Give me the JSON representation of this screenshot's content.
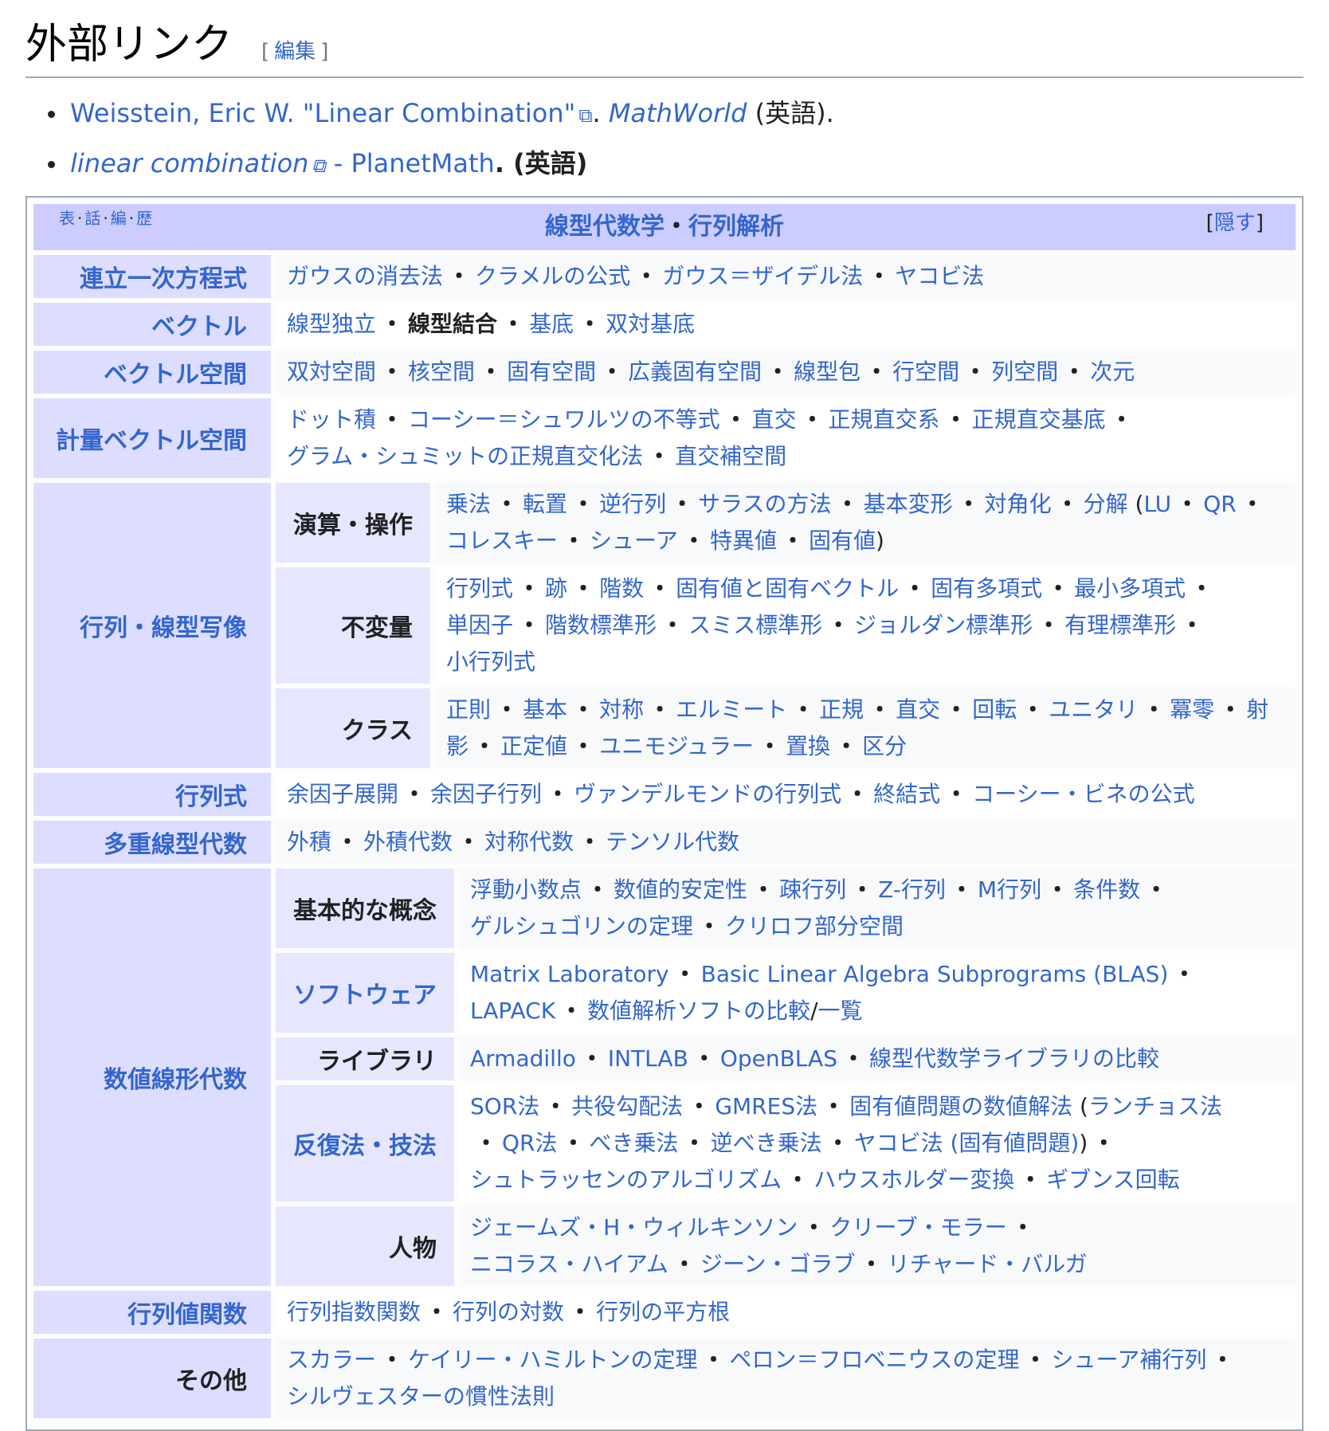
{
  "heading": {
    "title": "外部リンク",
    "edit_open": "[",
    "edit_label": "編集",
    "edit_close": "]"
  },
  "external_links": [
    {
      "author": "Weisstein, Eric W. \"Linear Combination\"",
      "mid": ". ",
      "site": "MathWorld",
      "tail": " (英語)."
    },
    {
      "title": "linear combination",
      "mid": " - PlanetMath",
      "tail": ". (英語)"
    }
  ],
  "navbox": {
    "vte": [
      "表",
      "話",
      "編",
      "歴"
    ],
    "title_part1": "線型代数学",
    "title_sep": "・",
    "title_part2": "行列解析",
    "hide_open": "[",
    "hide_label": "隠す",
    "hide_close": "]",
    "groups": {
      "g1": "連立一次方程式",
      "g2": "ベクトル",
      "g3": "ベクトル空間",
      "g4": "計量ベクトル空間",
      "g5": "行列・線型写像",
      "g5a": "演算・操作",
      "g5b": "不変量",
      "g5c": "クラス",
      "g6": "行列式",
      "g7": "多重線型代数",
      "g8": "数値線形代数",
      "g8a": "基本的な概念",
      "g8b": "ソフトウェア",
      "g8c": "ライブラリ",
      "g8d": "反復法・技法",
      "g8e": "人物",
      "g9": "行列値関数",
      "g10": "その他"
    },
    "lists": {
      "l1": [
        "ガウスの消去法",
        "クラメルの公式",
        "ガウス＝ザイデル法",
        "ヤコビ法"
      ],
      "l2a": "線型独立",
      "l2b": "線型結合",
      "l2c": "基底",
      "l2d": "双対基底",
      "l3": [
        "双対空間",
        "核空間",
        "固有空間",
        "広義固有空間",
        "線型包",
        "行空間",
        "列空間",
        "次元"
      ],
      "l4": [
        "ドット積",
        "コーシー＝シュワルツの不等式",
        "直交",
        "正規直交系",
        "正規直交基底",
        "グラム・シュミットの正規直交化法",
        "直交補空間"
      ],
      "l5a": [
        "乗法",
        "転置",
        "逆行列",
        "サラスの方法",
        "基本変形",
        "対角化",
        "分解"
      ],
      "l5a_open": " (",
      "l5a_paren": [
        "LU",
        "QR",
        "コレスキー",
        "シューア",
        "特異値",
        "固有値"
      ],
      "l5a_close": ")",
      "l5b": [
        "行列式",
        "跡",
        "階数",
        "固有値と固有ベクトル",
        "固有多項式",
        "最小多項式",
        "単因子",
        "階数標準形",
        "スミス標準形",
        "ジョルダン標準形",
        "有理標準形",
        "小行列式"
      ],
      "l5c": [
        "正則",
        "基本",
        "対称",
        "エルミート",
        "正規",
        "直交",
        "回転",
        "ユニタリ",
        "冪零",
        "射影",
        "正定値",
        "ユニモジュラー",
        "置換",
        "区分"
      ],
      "l6": [
        "余因子展開",
        "余因子行列",
        "ヴァンデルモンドの行列式",
        "終結式",
        "コーシー・ビネの公式"
      ],
      "l7": [
        "外積",
        "外積代数",
        "対称代数",
        "テンソル代数"
      ],
      "l8a": [
        "浮動小数点",
        "数値的安定性",
        "疎行列",
        "Z-行列",
        "M行列",
        "条件数",
        "ゲルシュゴリンの定理",
        "クリロフ部分空間"
      ],
      "l8b1": "Matrix Laboratory",
      "l8b2": "Basic Linear Algebra Subprograms (BLAS)",
      "l8b3": "LAPACK",
      "l8b4": "数値解析ソフトの比較",
      "l8b_slash": "/",
      "l8b5": "一覧",
      "l8c": [
        "Armadillo",
        "INTLAB",
        "OpenBLAS",
        "線型代数学ライブラリの比較"
      ],
      "l8d1": "SOR法",
      "l8d2": "共役勾配法",
      "l8d3": "GMRES法",
      "l8d4": "固有値問題の数値解法",
      "l8d_open": " (",
      "l8d5": "ランチョス法",
      "l8d6": "QR法",
      "l8d7": "べき乗法",
      "l8d8": "逆べき乗法",
      "l8d9": "ヤコビ法 (固有値問題)",
      "l8d_close": ")",
      "l8d10": "シュトラッセンのアルゴリズム",
      "l8d11": "ハウスホルダー変換",
      "l8d12": "ギブンス回転",
      "l8e": [
        "ジェームズ・H・ウィルキンソン",
        "クリーブ・モラー",
        "ニコラス・ハイアム",
        "ジーン・ゴラブ",
        "リチャード・バルガ"
      ],
      "l9": [
        "行列指数関数",
        "行列の対数",
        "行列の平方根"
      ],
      "l10": [
        "スカラー",
        "ケイリー・ハミルトンの定理",
        "ペロン＝フロベニウスの定理",
        "シューア補行列",
        "シルヴェスターの慣性法則"
      ]
    },
    "separator": "・"
  }
}
